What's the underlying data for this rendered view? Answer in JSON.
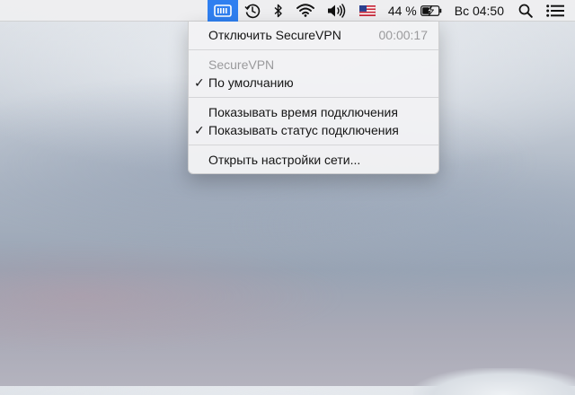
{
  "menubar": {
    "vpn_icon": "vpn-status-icon",
    "time_machine_icon": "time-machine-icon",
    "bluetooth_icon": "bluetooth-icon",
    "wifi_icon": "wifi-icon",
    "volume_icon": "volume-icon",
    "input_source_icon": "us-flag-icon",
    "battery_percent": "44 %",
    "battery_level": 0.44,
    "clock": "Вс 04:50",
    "spotlight_icon": "search-icon",
    "notification_icon": "notification-center-icon",
    "accent_color": "#2f7ff0"
  },
  "vpn_menu": {
    "disconnect_label": "Отключить SecureVPN",
    "connection_time": "00:00:17",
    "section_header": "SecureVPN",
    "default_label": "По умолчанию",
    "show_time_label": "Показывать время подключения",
    "show_status_label": "Показывать статус подключения",
    "open_network_prefs_label": "Открыть настройки сети...",
    "checkmark": "✓"
  }
}
